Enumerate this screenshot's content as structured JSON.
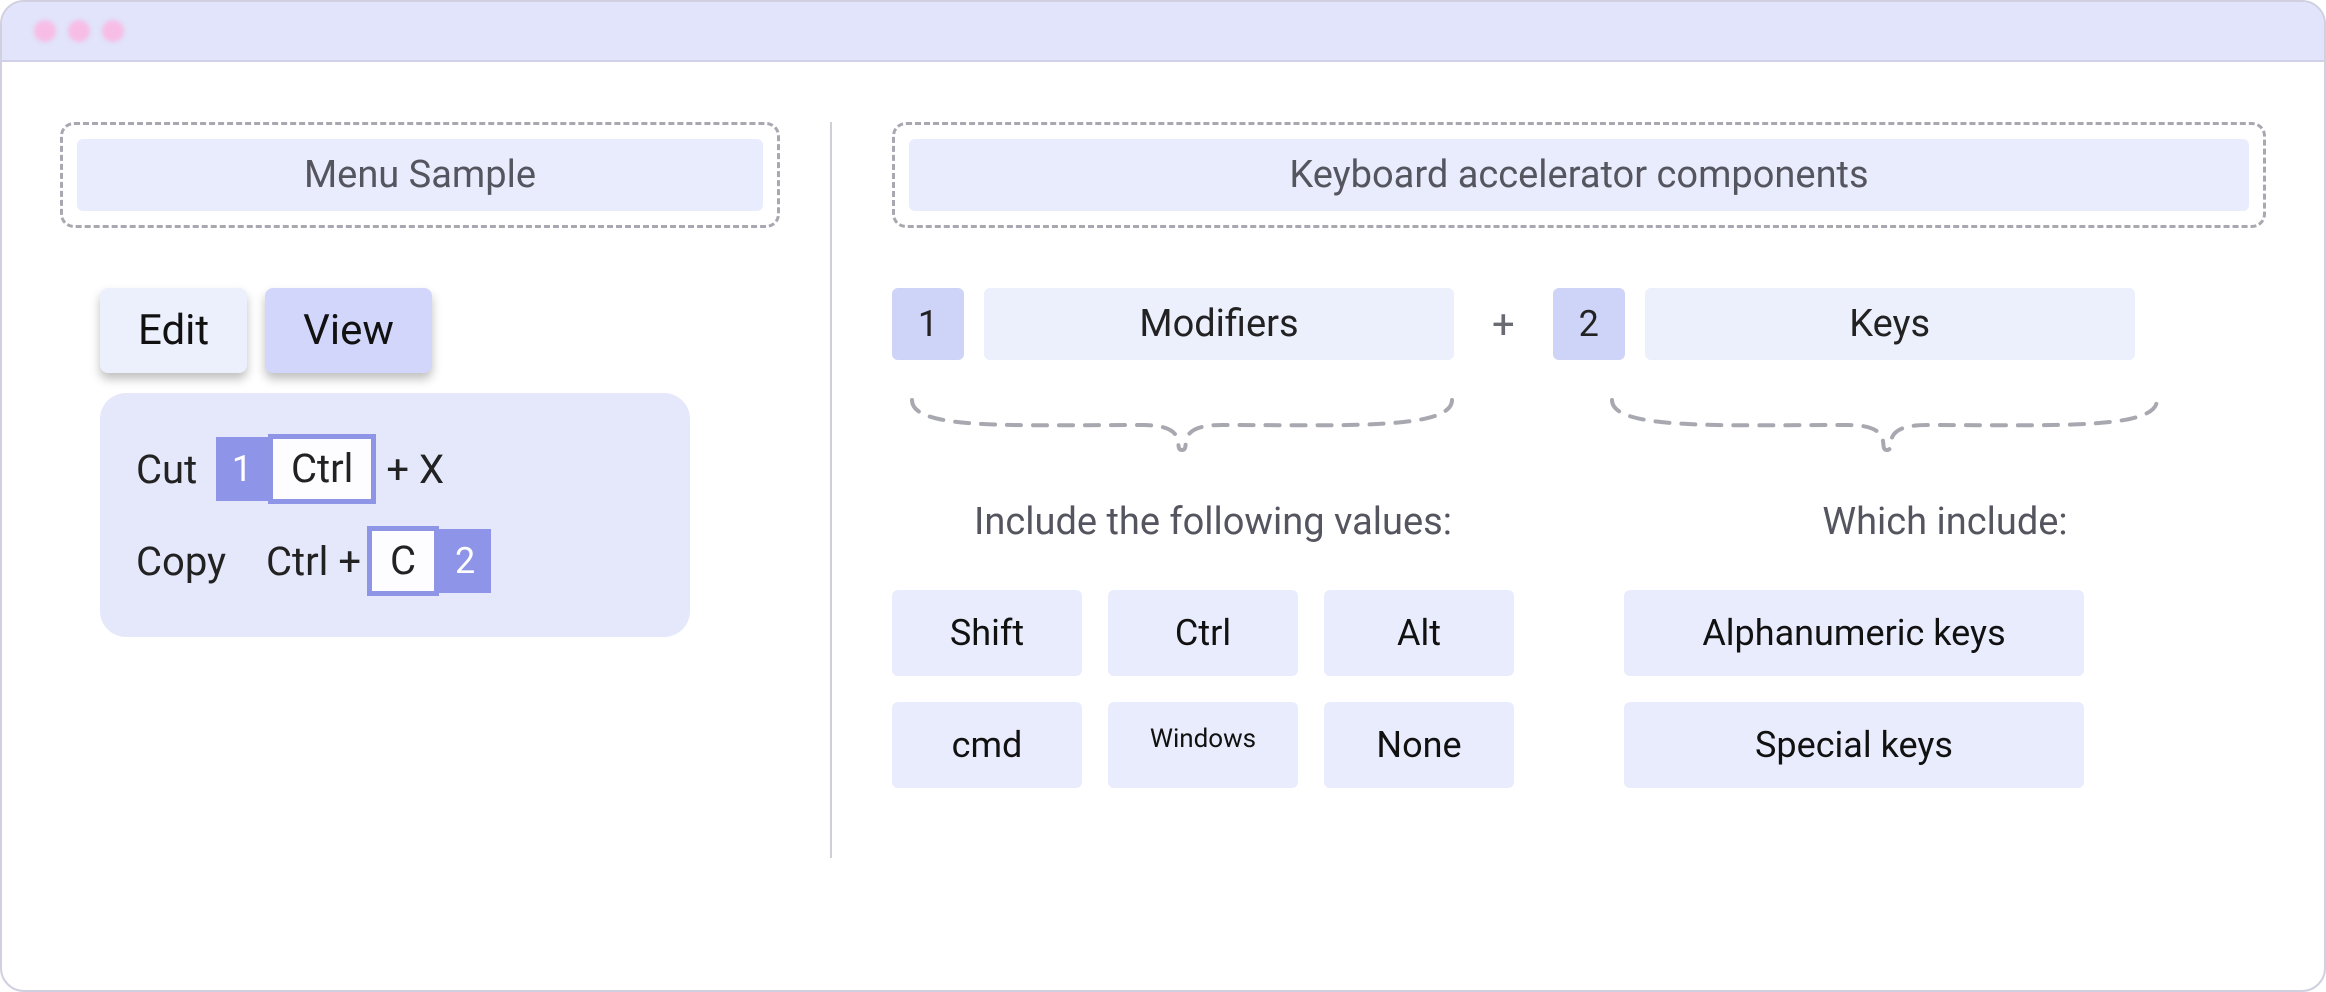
{
  "left": {
    "title": "Menu Sample",
    "tabs": {
      "edit": "Edit",
      "view": "View"
    },
    "rows": {
      "cut": {
        "label": "Cut",
        "annot_num": "1",
        "modifier": "Ctrl",
        "plus": "+ X"
      },
      "copy": {
        "label": "Copy",
        "prefix": "Ctrl +",
        "key": "C",
        "annot_num": "2"
      }
    }
  },
  "right": {
    "title": "Keyboard accelerator components",
    "comp": {
      "num1": "1",
      "label1": "Modifiers",
      "plus": "+",
      "num2": "2",
      "label2": "Keys"
    },
    "col1": {
      "heading": "Include the following values:",
      "keys": [
        "Shift",
        "Ctrl",
        "Alt",
        "cmd",
        "Windows",
        "None"
      ]
    },
    "col2": {
      "heading": "Which include:",
      "keys": [
        "Alphanumeric keys",
        "Special keys"
      ]
    }
  }
}
